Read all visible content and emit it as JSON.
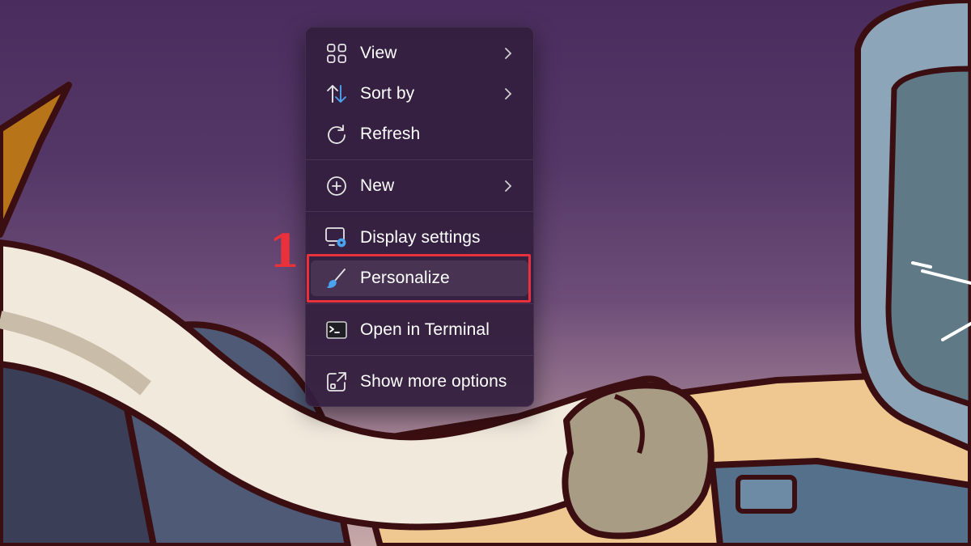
{
  "context_menu": {
    "items": [
      {
        "label": "View",
        "icon": "grid-icon",
        "submenu": true
      },
      {
        "label": "Sort by",
        "icon": "sort-arrows-icon",
        "submenu": true
      },
      {
        "label": "Refresh",
        "icon": "refresh-icon",
        "submenu": false
      },
      {
        "label": "New",
        "icon": "plus-circle-icon",
        "submenu": true
      },
      {
        "label": "Display settings",
        "icon": "display-settings-icon",
        "submenu": false
      },
      {
        "label": "Personalize",
        "icon": "brush-icon",
        "submenu": false,
        "highlighted": true
      },
      {
        "label": "Open in Terminal",
        "icon": "terminal-icon",
        "submenu": false
      },
      {
        "label": "Show more options",
        "icon": "show-more-options-icon",
        "submenu": false
      }
    ]
  },
  "annotation": {
    "step_number": "1",
    "color": "#e8313b"
  },
  "colors": {
    "menu_bg": "#341f3f",
    "accent_blue": "#4aa3f0",
    "text": "#ffffff"
  }
}
